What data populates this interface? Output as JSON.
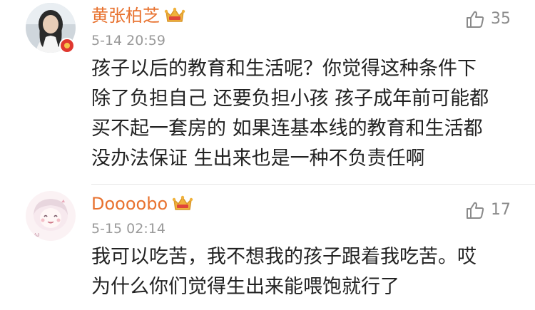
{
  "comments": [
    {
      "username": "黄张柏芝",
      "timestamp": "5-14 20:59",
      "likes": "35",
      "lines": [
        "孩子以后的教育和生活呢？你觉得这种条件下",
        "除了负担自己 还要负担小孩 孩子成年前可能都",
        "买不起一套房的 如果连基本线的教育和生活都",
        "没办法保证 生出来也是一种不负责任啊"
      ],
      "avatar_icon": "avatar-photo-woman",
      "badge_icon": "verified-badge-icon"
    },
    {
      "username": "Doooobo",
      "timestamp": "5-15 02:14",
      "likes": "17",
      "lines": [
        "我可以吃苦，我不想我的孩子跟着我吃苦。哎",
        "为什么你们觉得生出来能喂饱就行了"
      ],
      "avatar_icon": "avatar-anime-girl"
    }
  ],
  "icons": {
    "crown": "vip-crown-icon",
    "like": "thumbs-up-icon"
  },
  "colors": {
    "username": "#e8722f",
    "timestamp": "#9a9a9a",
    "body": "#222222",
    "like": "#8a8a8a",
    "crown": "#f0b23c"
  }
}
